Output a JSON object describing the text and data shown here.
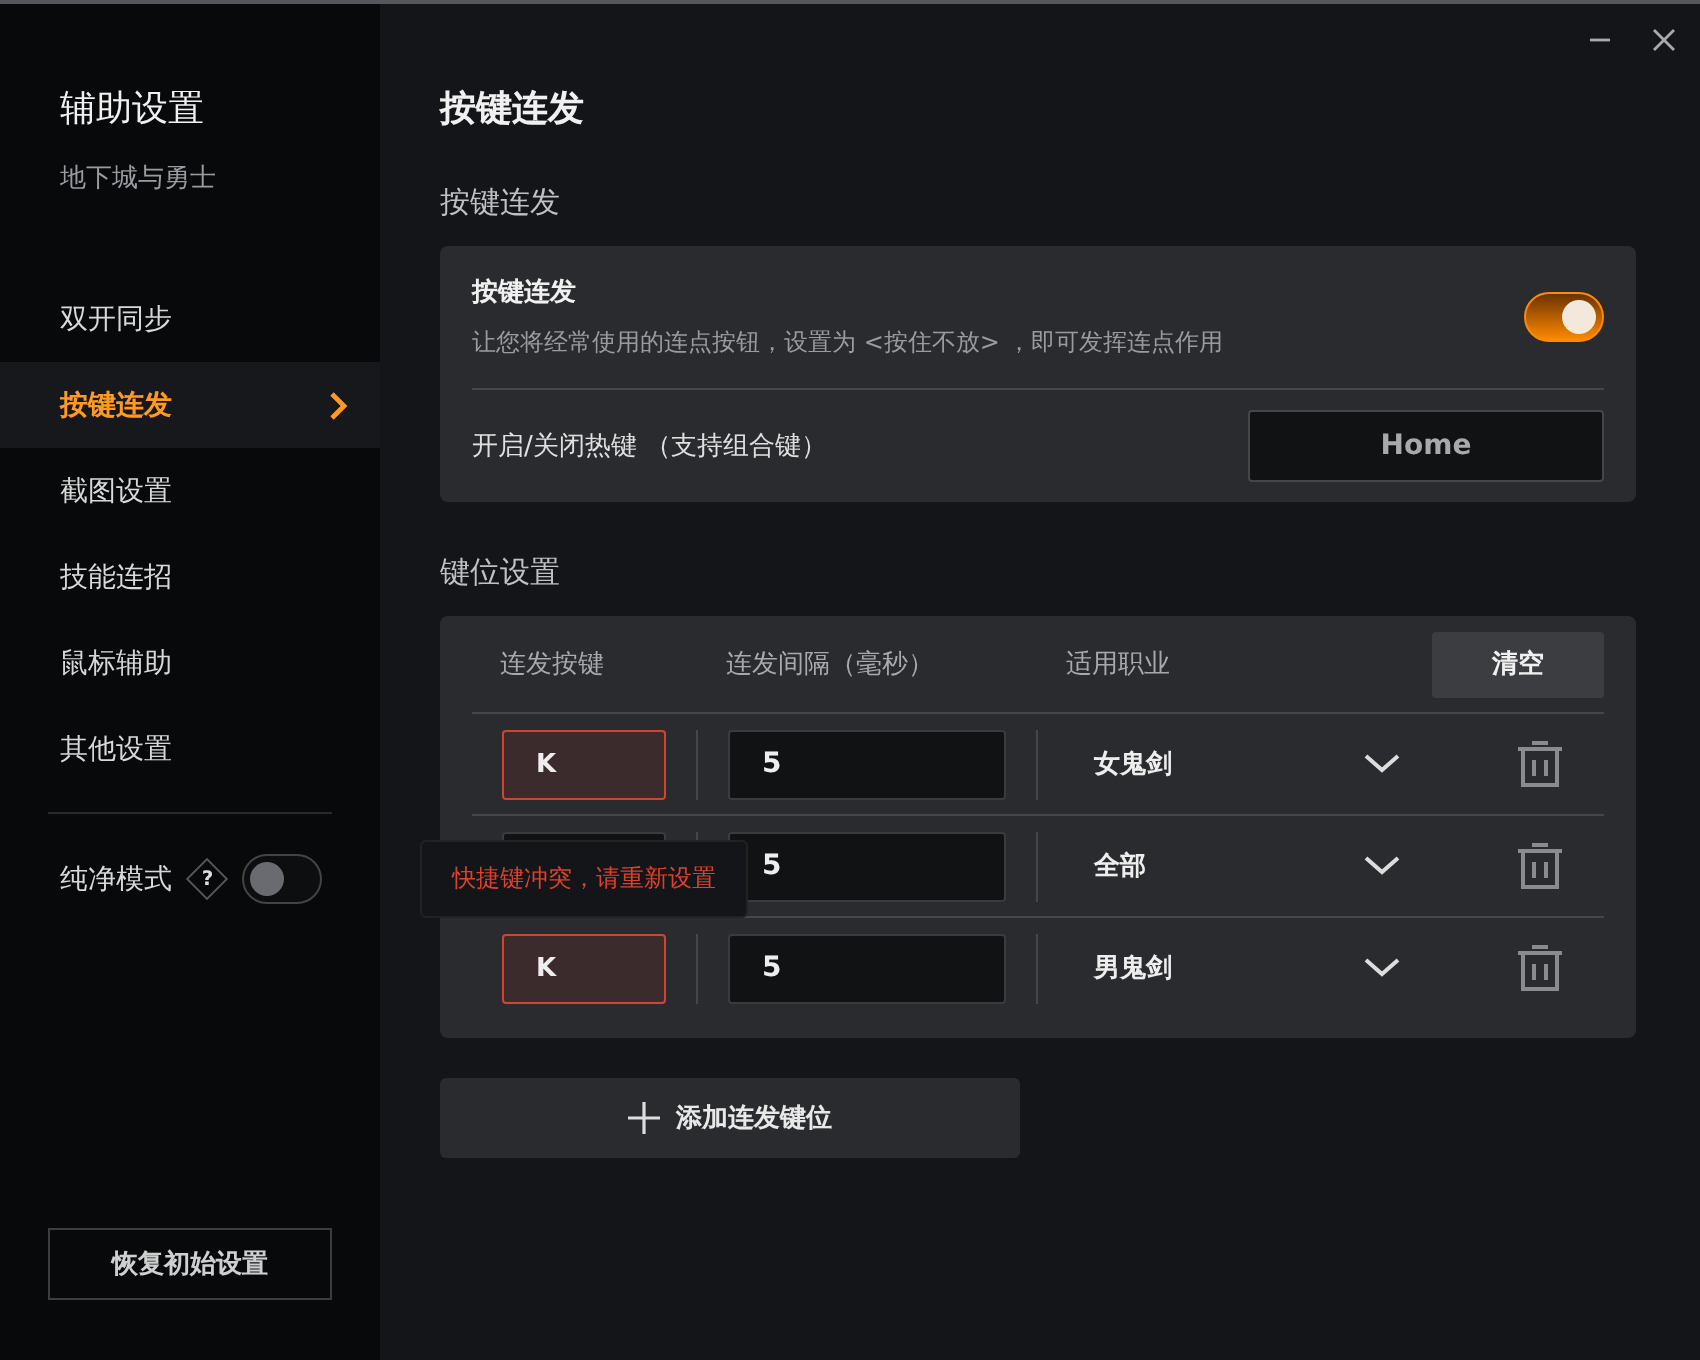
{
  "sidebar": {
    "title": "辅助设置",
    "subtitle": "地下城与勇士",
    "items": [
      {
        "label": "双开同步",
        "selected": false
      },
      {
        "label": "按键连发",
        "selected": true
      },
      {
        "label": "截图设置",
        "selected": false
      },
      {
        "label": "技能连招",
        "selected": false
      },
      {
        "label": "鼠标辅助",
        "selected": false
      },
      {
        "label": "其他设置",
        "selected": false
      }
    ],
    "pure_mode": {
      "label": "纯净模式",
      "help": "?",
      "on": false
    },
    "reset_button": "恢复初始设置"
  },
  "page_title": "按键连发",
  "repeat_section": {
    "heading": "按键连发",
    "title": "按键连发",
    "description": "让您将经常使用的连点按钮，设置为 <按住不放> ，即可发挥连点作用",
    "on": true,
    "hotkey_label": "开启/关闭热键 （支持组合键）",
    "hotkey": "Home"
  },
  "keys_section": {
    "heading": "键位设置",
    "columns": [
      "连发按键",
      "连发间隔（毫秒）",
      "适用职业"
    ],
    "clear_button": "清空",
    "rows": [
      {
        "key": "K",
        "conflict": true,
        "interval": "5",
        "class": "女鬼剑"
      },
      {
        "conflict": false,
        "interval": "5",
        "class": "全部"
      },
      {
        "key": "K",
        "conflict": true,
        "interval": "5",
        "class": "男鬼剑"
      }
    ],
    "tooltip": "快捷键冲突，请重新设置",
    "add_button": "添加连发键位"
  }
}
